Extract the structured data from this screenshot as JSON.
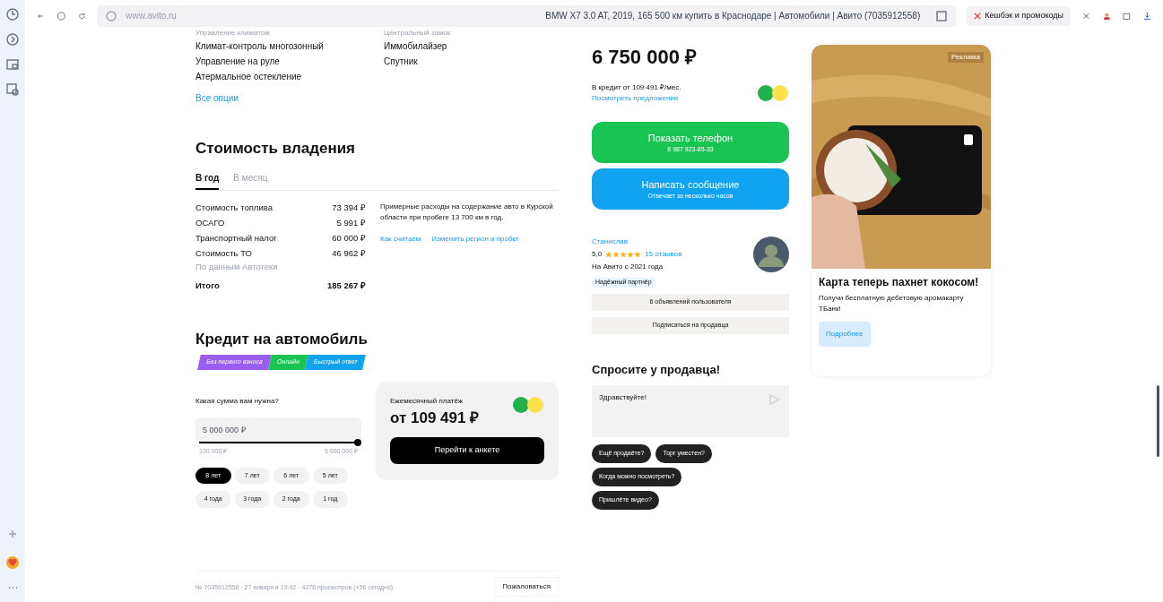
{
  "browser": {
    "url": "www.avito.ru",
    "title": "BMW X7 3.0 AT, 2019, 165 500 км купить в Краснодаре | Автомобили | Авито (7035912558)",
    "cashback": "Кешбэк и промокоды"
  },
  "options": {
    "columns": [
      [
        "Управление климатом",
        "Климат-контроль многозонный",
        "Управление на руле",
        "Атермальное остекление"
      ],
      [
        "Центральный замок",
        "Иммобилайзер",
        "Спутник"
      ]
    ],
    "all_link": "Все опции"
  },
  "ownership": {
    "title": "Стоимость владения",
    "tabs": [
      {
        "label": "В год",
        "selected": true
      },
      {
        "label": "В месяц",
        "selected": false
      }
    ],
    "rows": [
      {
        "label": "Стоимость топлива",
        "value": "73 394 ₽"
      },
      {
        "label": "ОСАГО",
        "value": "5 991 ₽"
      },
      {
        "label": "Транспортный налог",
        "value": "60 000 ₽"
      },
      {
        "label": "Стоимость ТО",
        "value": "46 962 ₽",
        "note": "По данным Автотеки"
      }
    ],
    "total": {
      "label": "Итого",
      "value": "185 267 ₽"
    },
    "description": "Примерные расходы на содержание авто в Курской области при пробеге 13 700 км в год.",
    "links": [
      "Как считаем",
      "Изменить регион и пробег"
    ]
  },
  "credit": {
    "title": "Кредит на автомобиль",
    "tags": [
      {
        "label": "Без первого взноса",
        "color": "#9b5cf0"
      },
      {
        "label": "Онлайн",
        "color": "#19c452"
      },
      {
        "label": "Быстрый ответ",
        "color": "#12a3f0"
      }
    ],
    "amount_label": "Какая сумма вам нужна?",
    "amount": "5 000 000 ₽",
    "level": 1,
    "min": "100 000 ₽",
    "max": "5 000 000 ₽",
    "terms": [
      {
        "label": "8 лет",
        "selected": true
      },
      {
        "label": "7 лет",
        "selected": false
      },
      {
        "label": "6 лет",
        "selected": false
      },
      {
        "label": "5 лет",
        "selected": false
      },
      {
        "label": "4 года",
        "selected": false
      },
      {
        "label": "3 года",
        "selected": false
      },
      {
        "label": "2 года",
        "selected": false
      },
      {
        "label": "1 год",
        "selected": false
      }
    ],
    "payment_label": "Ежемесячный платёж",
    "payment": "от 109 491 ₽",
    "apply": "Перейти к анкете"
  },
  "footer": {
    "info": "№ 7035912558 · 27 января в 19:42 · 4376 просмотров (+56 сегодня)",
    "report": "Пожаловаться"
  },
  "price": {
    "value": "6 750 000 ₽",
    "credit": "В кредит от 109 491 ₽/мес.",
    "offers": "Посмотреть предложения"
  },
  "phone_button": {
    "label": "Показать телефон",
    "sub": "8 987 923-85-33"
  },
  "message_button": {
    "label": "Написать сообщение",
    "sub": "Отвечает за несколько часов"
  },
  "seller": {
    "name": "Станислав",
    "rating": "5,0",
    "stars": 5,
    "reviews": "15 отзывов",
    "since": "На Авито с 2021 года",
    "badge": "Надёжный партнёр",
    "buttons": [
      "6 объявлений пользователя",
      "Подписаться на продавца"
    ]
  },
  "ask": {
    "title": "Спросите у продавца!",
    "message": "Здравствуйте!",
    "chips": [
      "Ещё продаёте?",
      "Торг уместен?",
      "Когда можно посмотреть?",
      "Пришлёте видео?"
    ]
  },
  "ad": {
    "badge": "Реклама",
    "title": "Карта теперь пахнет кокосом!",
    "text": "Получи бесплатную дебетовую аромакарту ТБанк!",
    "button": "Подробнее"
  }
}
